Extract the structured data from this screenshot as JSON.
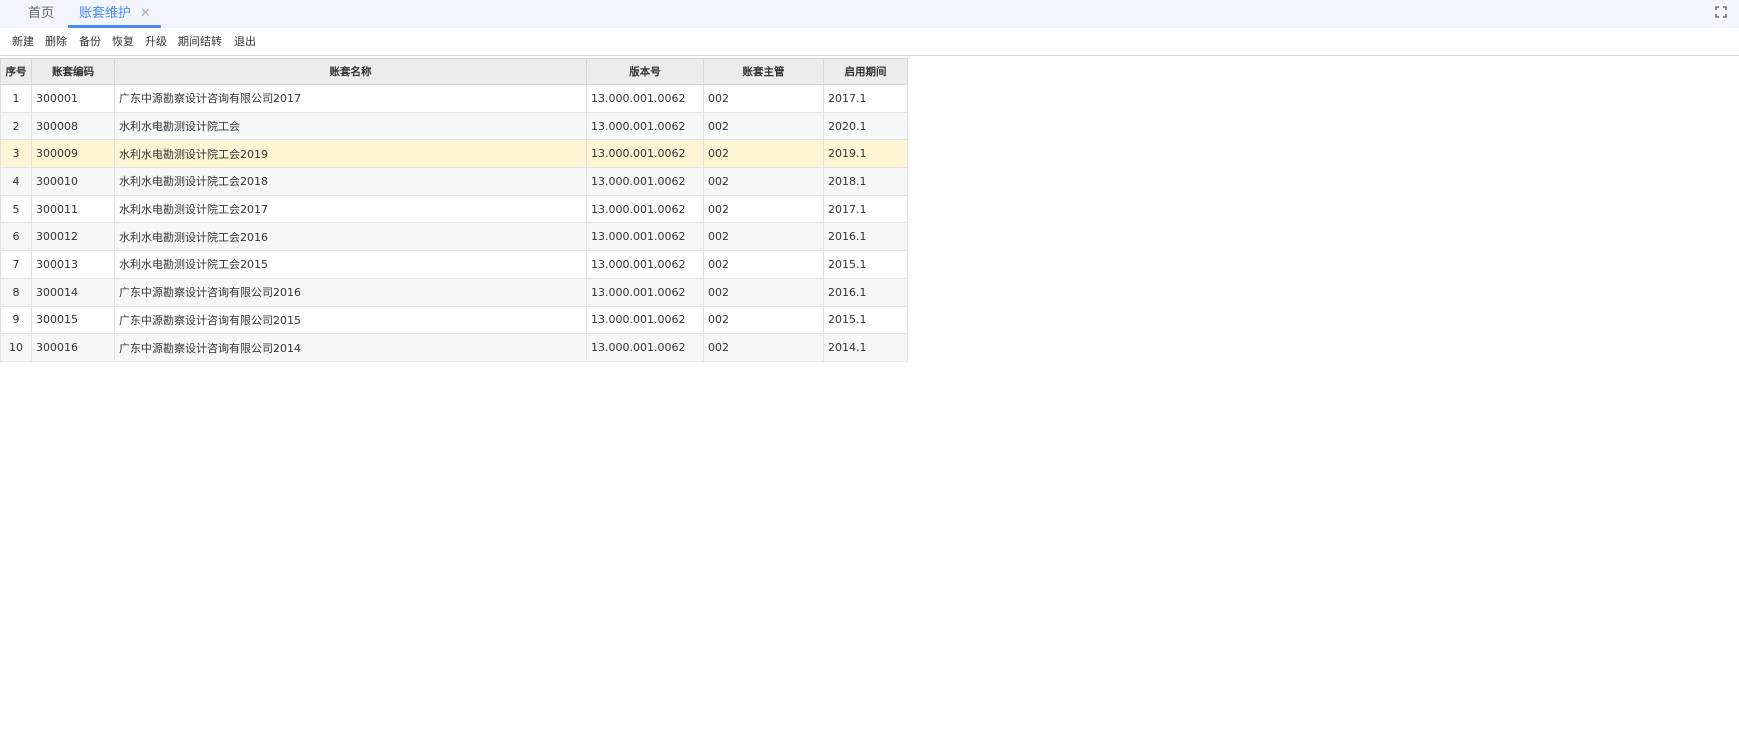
{
  "tabs": {
    "home_label": "首页",
    "active_label": "账套维护",
    "close_glyph": "✕"
  },
  "toolbar": {
    "new": "新建",
    "delete": "删除",
    "backup": "备份",
    "restore": "恢复",
    "upgrade": "升级",
    "period_close": "期间结转",
    "exit": "退出"
  },
  "table": {
    "headers": [
      "序号",
      "账套编码",
      "账套名称",
      "版本号",
      "账套主管",
      "启用期间"
    ],
    "selected_row": 3,
    "rows": [
      [
        "1",
        "300001",
        "广东中源勘察设计咨询有限公司2017",
        "13.000.001.0062",
        "002",
        "2017.1"
      ],
      [
        "2",
        "300008",
        "水利水电勘测设计院工会",
        "13.000.001.0062",
        "002",
        "2020.1"
      ],
      [
        "3",
        "300009",
        "水利水电勘测设计院工会2019",
        "13.000.001.0062",
        "002",
        "2019.1"
      ],
      [
        "4",
        "300010",
        "水利水电勘测设计院工会2018",
        "13.000.001.0062",
        "002",
        "2018.1"
      ],
      [
        "5",
        "300011",
        "水利水电勘测设计院工会2017",
        "13.000.001.0062",
        "002",
        "2017.1"
      ],
      [
        "6",
        "300012",
        "水利水电勘测设计院工会2016",
        "13.000.001.0062",
        "002",
        "2016.1"
      ],
      [
        "7",
        "300013",
        "水利水电勘测设计院工会2015",
        "13.000.001.0062",
        "002",
        "2015.1"
      ],
      [
        "8",
        "300014",
        "广东中源勘察设计咨询有限公司2016",
        "13.000.001.0062",
        "002",
        "2016.1"
      ],
      [
        "9",
        "300015",
        "广东中源勘察设计咨询有限公司2015",
        "13.000.001.0062",
        "002",
        "2015.1"
      ],
      [
        "10",
        "300016",
        "广东中源勘察设计咨询有限公司2014",
        "13.000.001.0062",
        "002",
        "2014.1"
      ]
    ]
  },
  "icons": {
    "fullscreen": "fullscreen-icon",
    "close": "close-icon"
  },
  "colors": {
    "accent": "#4a8af4",
    "selected_row": "#fdf5d3",
    "header_bg": "#ececec",
    "tabbar_bg": "#f2f6fc"
  }
}
